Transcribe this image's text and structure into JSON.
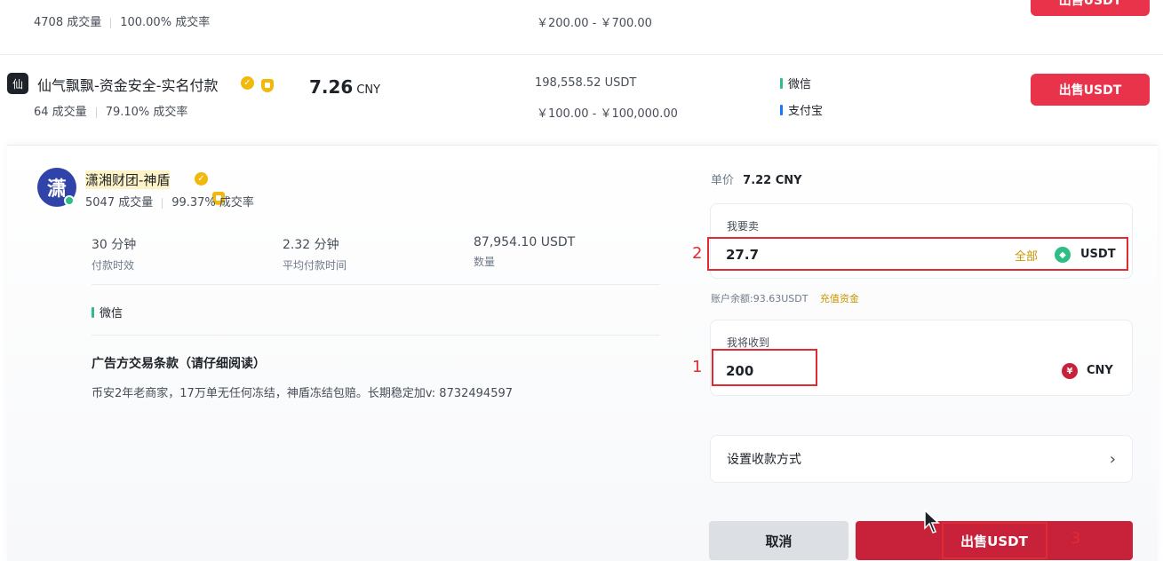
{
  "row1": {
    "stats_orders": "4708 成交量",
    "stats_rate": "100.00% 成交率",
    "limit": "￥200.00 - ￥700.00",
    "sell_label": "出售USDT"
  },
  "row2": {
    "merchant_name": "仙气飘飘-资金安全-实名付款",
    "stats_orders": "64 成交量",
    "stats_rate": "79.10% 成交率",
    "price": "7.26",
    "price_unit": "CNY",
    "available": "198,558.52 USDT",
    "limit": "￥100.00 - ￥100,000.00",
    "payments": [
      "微信",
      "支付宝"
    ],
    "sell_label": "出售USDT"
  },
  "panel": {
    "avatar_char": "潇",
    "merchant_name": "潇湘财团-神盾",
    "stats_orders": "5047 成交量",
    "stats_rate": "99.37% 成交率",
    "metrics": [
      {
        "value": "30 分钟",
        "label": "付款时效"
      },
      {
        "value": "2.32 分钟",
        "label": "平均付款时间"
      },
      {
        "value": "87,954.10 USDT",
        "label": "数量"
      }
    ],
    "payment": "微信",
    "terms_title": "广告方交易条款（请仔细阅读）",
    "terms_text": "币安2年老商家，17万单无任何冻结，神盾冻结包赔。长期稳定加v: 8732494597"
  },
  "form": {
    "unit_price_label": "单价",
    "unit_price_value": "7.22 CNY",
    "sell_label": "我要卖",
    "sell_value": "27.7",
    "all_label": "全部",
    "sell_currency": "USDT",
    "balance_text": "账户余额:93.63USDT",
    "recharge_label": "充值资金",
    "receive_label": "我将收到",
    "receive_value": "200",
    "receive_currency": "CNY",
    "receive_currency_symbol": "¥",
    "payment_method_label": "设置收款方式",
    "cancel_label": "取消",
    "confirm_label": "出售USDT"
  },
  "annotations": {
    "num1": "1",
    "num2": "2",
    "num3": "3"
  },
  "colors": {
    "sell_red": "#e8334a",
    "badge_gold": "#f0b90b",
    "wechat_green": "#2ebd85",
    "alipay_blue": "#1677ff",
    "annotation_red": "#e02b35"
  }
}
